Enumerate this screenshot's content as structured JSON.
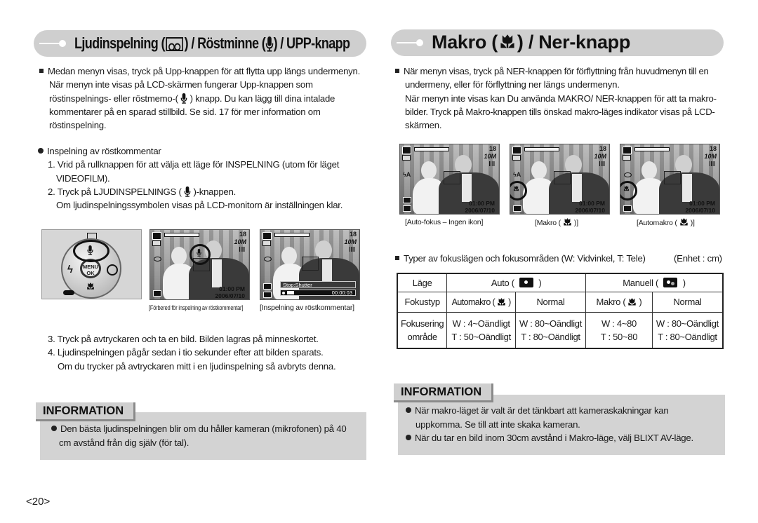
{
  "left": {
    "header": {
      "title_part1": "Ljudinspelning (",
      "icon1": "voice-memo-tape-icon",
      "title_part2": ") / Röstminne (",
      "icon2": "microphone-icon",
      "title_part3": ") / UPP-knapp"
    },
    "intro": {
      "line1": "Medan menyn visas, tryck på Upp-knappen för att flytta upp längs undermenyn.",
      "line2": "När menyn inte visas på LCD-skärmen fungerar Upp-knappen som",
      "line3a": "röstinspelnings- eller röstmemo-(",
      "line3b": ") knapp. Du kan lägg till dina intalade",
      "line4": "kommentarer på en sparad stillbild. Se sid. 17 för mer information om",
      "line5": "röstinspelning."
    },
    "steps": {
      "heading": "Inspelning av röstkommentar",
      "step1_line1": "1. Vrid på rullknappen för att välja ett läge för INSPELNING (utom för läget",
      "step1_line2": "VIDEOFILM).",
      "step2_a": "2. Tryck på LJUDINSPELNINGS (",
      "step2_b": ")-knappen.",
      "step2_line2": "Om ljudinspelningssymbolen visas på LCD-monitorn är inställningen klar.",
      "step3": "3. Tryck på avtryckaren och ta en bild. Bilden lagras på minneskortet.",
      "step4_line1": "4. Ljudinspelningen pågår sedan i tio sekunder efter att bilden sparats.",
      "step4_line2": "Om du trycker på avtryckaren mitt i en ljudinspelning så avbryts denna."
    },
    "dial": {
      "menu_label": "MENU",
      "ok_label": "OK"
    },
    "screens": [
      {
        "count": "18",
        "size": "10M",
        "time": "01:00 PM",
        "date": "2006/07/10",
        "caption": "[Förbered för inspelning av röstkommentar]"
      },
      {
        "count": "18",
        "size": "10M",
        "stop_label": "Stop:Shutter",
        "timer": "00:00:03",
        "caption": "[Inspelning av röstkommentar]"
      }
    ],
    "info": {
      "title": "INFORMATION",
      "items": [
        "Den bästa ljudinspelningen blir om du håller kameran (mikrofonen) på 40",
        "cm avstånd från dig själv (för tal)."
      ]
    }
  },
  "right": {
    "header": {
      "title_part1": "Makro (",
      "icon": "macro-tulip-icon",
      "title_part2": ") / Ner-knapp"
    },
    "intro": {
      "line1": "När menyn visas, tryck på NER-knappen för förflyttning från huvudmenyn till en",
      "line2": "undermeny, eller för förflyttning ner längs undermenyn.",
      "line3": "När menyn inte visas kan Du använda MAKRO/ NER-knappen för att ta makro-",
      "line4": "bilder. Tryck på Makro-knappen tills önskad makro-läges indikator visas på LCD-",
      "line5": "skärmen."
    },
    "screens": [
      {
        "count": "18",
        "size": "10M",
        "time": "01:00 PM",
        "date": "2006/07/10",
        "caption": "[Auto-fokus – Ingen ikon]"
      },
      {
        "count": "18",
        "size": "10M",
        "time": "01:00 PM",
        "date": "2006/07/10",
        "caption_a": "[Makro (",
        "caption_b": ")]"
      },
      {
        "count": "18",
        "size": "10M",
        "time": "01:00 PM",
        "date": "2006/07/10",
        "caption_a": "[Automakro (",
        "caption_b": ")]"
      }
    ],
    "table_intro": "Typer av fokuslägen och fokusområden (W: Vidvinkel, T: Tele)",
    "table_unit": "(Enhet : cm)",
    "table": {
      "row_mode": {
        "label": "Läge",
        "auto": "Auto (",
        "auto_close": ")",
        "manual": "Manuell  (",
        "manual_close": ")"
      },
      "row_type": {
        "label": "Fokustyp",
        "c1": "Automakro (",
        "c1_close": ")",
        "c2": "Normal",
        "c3": "Makro (",
        "c3_close": ")",
        "c4": "Normal"
      },
      "row_range": {
        "label1": "Fokusering",
        "label2": "område",
        "c1": [
          "W : 4~Oändligt",
          "T : 50~Oändligt"
        ],
        "c2": [
          "W : 80~Oändligt",
          "T : 80~Oändligt"
        ],
        "c3": [
          "W : 4~80",
          "T : 50~80"
        ],
        "c4": [
          "W : 80~Oändligt",
          "T : 80~Oändligt"
        ]
      }
    },
    "info": {
      "title": "INFORMATION",
      "items": [
        "När makro-läget är valt är det tänkbart att kameraskakningar kan",
        "uppkomma. Se till att inte skaka kameran.",
        "När du tar en bild inom 30cm avstånd i Makro-läge, välj BLIXT AV-läge."
      ]
    }
  },
  "page_number": "<20>"
}
